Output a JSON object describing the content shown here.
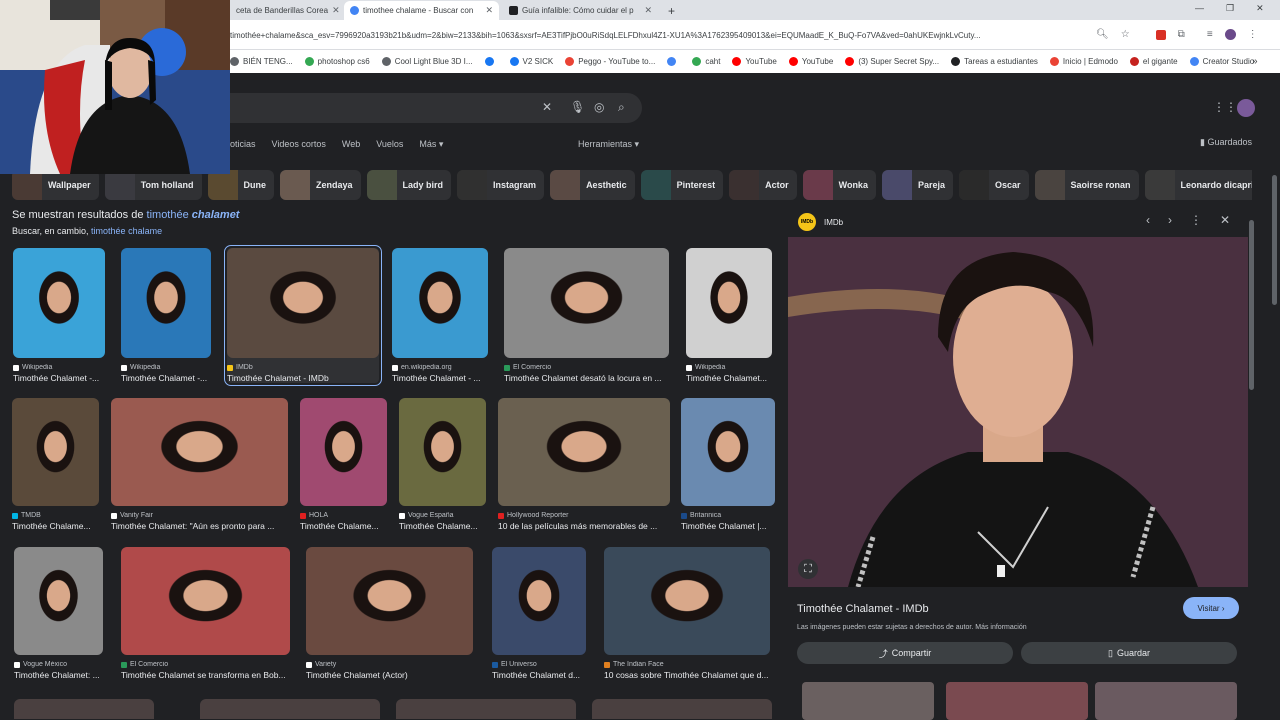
{
  "browser": {
    "tabs": [
      {
        "label": "ceta de Banderillas Corea",
        "close": "✕"
      },
      {
        "label": "timothee chalame - Buscar con",
        "close": "✕"
      },
      {
        "label": "Guía infalible: Cómo cuidar el p",
        "close": "✕"
      }
    ],
    "new_tab": "+",
    "url": "timothée+chalame&sca_esv=7996920a3193b21b&udm=2&biw=2133&bih=1063&sxsrf=AE3TifPjbO0uRiSdqLELFDhxul4Z1-XU1A%3A1762395409013&ei=EQUMaadE_K_BuQ-Fo7VA&ved=0ahUKEwjnkLvCuty...",
    "bookmarks": [
      {
        "label": "BIÉN TENG...",
        "color": "#5f6368"
      },
      {
        "label": "photoshop cs6",
        "color": "#34a853"
      },
      {
        "label": "Cool Light Blue 3D I...",
        "color": "#5f6368"
      },
      {
        "label": "",
        "color": "#1877f2"
      },
      {
        "label": "V2 SICK",
        "color": "#1877f2"
      },
      {
        "label": "Peggo - YouTube to...",
        "color": "#ea4335"
      },
      {
        "label": "",
        "color": "#4285f4"
      },
      {
        "label": "caht",
        "color": "#34a853"
      },
      {
        "label": "YouTube",
        "color": "#ff0000"
      },
      {
        "label": "YouTube",
        "color": "#ff0000"
      },
      {
        "label": "(3) Super Secret Spy...",
        "color": "#ff0000"
      },
      {
        "label": "Tareas a estudiantes",
        "color": "#202124"
      },
      {
        "label": "Inicio | Edmodo",
        "color": "#ea4335"
      },
      {
        "label": "el gigante",
        "color": "#c5221f"
      },
      {
        "label": "Creator Studio",
        "color": "#4285f4"
      }
    ]
  },
  "search": {
    "filters": [
      "oticias",
      "Videos cortos",
      "Web",
      "Vuelos",
      "Más ▾"
    ],
    "tools": "Herramientas ▾",
    "saved": "Guardados",
    "chips": [
      {
        "label": "Wallpaper",
        "color": "#4a3a34"
      },
      {
        "label": "Tom holland",
        "color": "#3a3a40"
      },
      {
        "label": "Dune",
        "color": "#5a4a30"
      },
      {
        "label": "Zendaya",
        "color": "#6a5a50"
      },
      {
        "label": "Lady bird",
        "color": "#4a5040"
      },
      {
        "label": "Instagram",
        "color": "#303030"
      },
      {
        "label": "Aesthetic",
        "color": "#5a4a44"
      },
      {
        "label": "Pinterest",
        "color": "#2a4a4a"
      },
      {
        "label": "Actor",
        "color": "#3a3030"
      },
      {
        "label": "Wonka",
        "color": "#6a3a4a"
      },
      {
        "label": "Pareja",
        "color": "#4a4a6a"
      },
      {
        "label": "Oscar",
        "color": "#2a2a2a"
      },
      {
        "label": "Saoirse ronan",
        "color": "#4a4440"
      },
      {
        "label": "Leonardo dicaprio",
        "color": "#3a3a3a"
      }
    ],
    "notice_prefix": "Se muestran resultados de ",
    "notice_term_a": "timothée ",
    "notice_term_b": "chalamet",
    "instead_prefix": "Buscar, en cambio, ",
    "instead_term": "timothée chalame"
  },
  "results": [
    {
      "source": "Wikipedia",
      "title": "Timothée Chalamet -...",
      "bg": "#3aa3d8",
      "dot": "#ffffff"
    },
    {
      "source": "Wikipedia",
      "title": "Timothée Chalamet -...",
      "bg": "#2a78b8",
      "dot": "#ffffff"
    },
    {
      "source": "IMDb",
      "title": "Timothée Chalamet - IMDb",
      "bg": "#5a4a40",
      "dot": "#f5c518"
    },
    {
      "source": "en.wikipedia.org",
      "title": "Timothée Chalamet - ...",
      "bg": "#3a9ad0",
      "dot": "#ffffff"
    },
    {
      "source": "El Comercio",
      "title": "Timothée Chalamet desató la locura en ...",
      "bg": "#8a8a8a",
      "dot": "#2a9a5a"
    },
    {
      "source": "Wikipedia",
      "title": "Timothée Chalamet...",
      "bg": "#d0d0d0",
      "dot": "#ffffff"
    },
    {
      "source": "TMDB",
      "title": "Timothée Chalame...",
      "bg": "#5a4a3a",
      "dot": "#01b4e4"
    },
    {
      "source": "Vanity Fair",
      "title": "Timothée Chalamet: \"Aún es pronto para ...",
      "bg": "#9a5a50",
      "dot": "#ffffff"
    },
    {
      "source": "HOLA",
      "title": "Timothée Chalame...",
      "bg": "#a04a70",
      "dot": "#e02020"
    },
    {
      "source": "Vogue España",
      "title": "Timothée Chalame...",
      "bg": "#6a6a40",
      "dot": "#ffffff"
    },
    {
      "source": "Hollywood Reporter",
      "title": "10 de las películas más memorables de ...",
      "bg": "#6a6050",
      "dot": "#e02020"
    },
    {
      "source": "Britannica",
      "title": "Timothée Chalamet |...",
      "bg": "#6a8ab0",
      "dot": "#1a4a8a"
    },
    {
      "source": "Vogue México",
      "title": "Timothée Chalamet: ...",
      "bg": "#8a8a8a",
      "dot": "#ffffff"
    },
    {
      "source": "El Comercio",
      "title": "Timothée Chalamet se transforma en Bob...",
      "bg": "#b04a4a",
      "dot": "#2a9a5a"
    },
    {
      "source": "Variety",
      "title": "Timothée Chalamet (Actor)",
      "bg": "#6a4a40",
      "dot": "#ffffff"
    },
    {
      "source": "El Universo",
      "title": "Timothée Chalamet d...",
      "bg": "#3a4a6a",
      "dot": "#1a5aa0"
    },
    {
      "source": "The Indian Face",
      "title": "10 cosas sobre Timothée Chalamet que d...",
      "bg": "#3a4a5a",
      "dot": "#e08020"
    }
  ],
  "preview": {
    "source": "IMDb",
    "logo_text": "IMDb",
    "controls": [
      "‹",
      "›",
      "⋮",
      "✕"
    ],
    "title": "Timothée Chalamet - IMDb",
    "visit": "Visitar ›",
    "copyright": "Las imágenes pueden estar sujetas a derechos de autor.",
    "more_info": "Más información",
    "share": "Compartir",
    "save": "Guardar",
    "lens": "⛶"
  }
}
